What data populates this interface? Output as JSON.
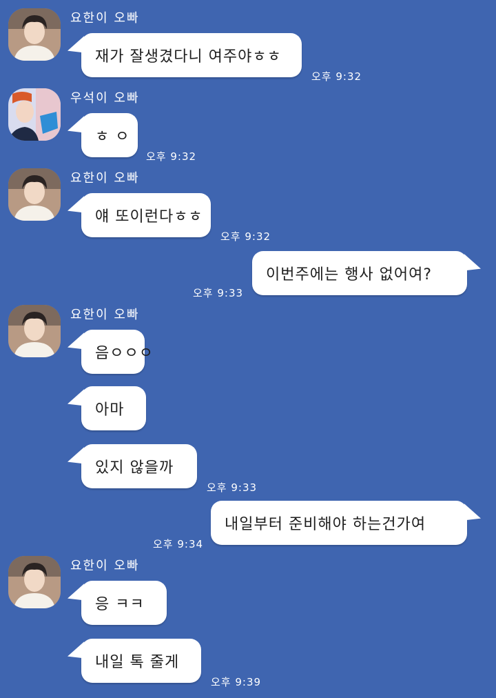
{
  "colors": {
    "background": "#3f65b0",
    "bubble": "#ffffff",
    "text": "#1e1e1e",
    "meta_text": "#ffffff"
  },
  "messages": [
    {
      "sender": "요한이 오빠",
      "text": "재가 잘생겼다니 여주야ㅎㅎ",
      "time": "오후 9:32"
    },
    {
      "sender": "우석이 오빠",
      "text": "ㅎ ㅇ",
      "time": "오후 9:32"
    },
    {
      "sender": "요한이 오빠",
      "text": "얘 또이런다ㅎㅎ",
      "time": "오후 9:32"
    },
    {
      "sender": "me",
      "text": "이번주에는 행사 없어여?",
      "time": "오후 9:33"
    },
    {
      "sender": "요한이 오빠",
      "lines": [
        "음ㅇㅇㅇ",
        "아마",
        "있지 않을까"
      ],
      "time": "오후 9:33"
    },
    {
      "sender": "me",
      "text": "내일부터 준비해야 하는건가여",
      "time": "오후 9:34"
    },
    {
      "sender": "요한이 오빠",
      "lines": [
        "응 ㅋㅋ",
        "내일 톡 줄게"
      ],
      "time": "오후 9:39"
    }
  ],
  "icons": {
    "avatar_yohan": "avatar-icon",
    "avatar_wooseok": "avatar-icon"
  }
}
